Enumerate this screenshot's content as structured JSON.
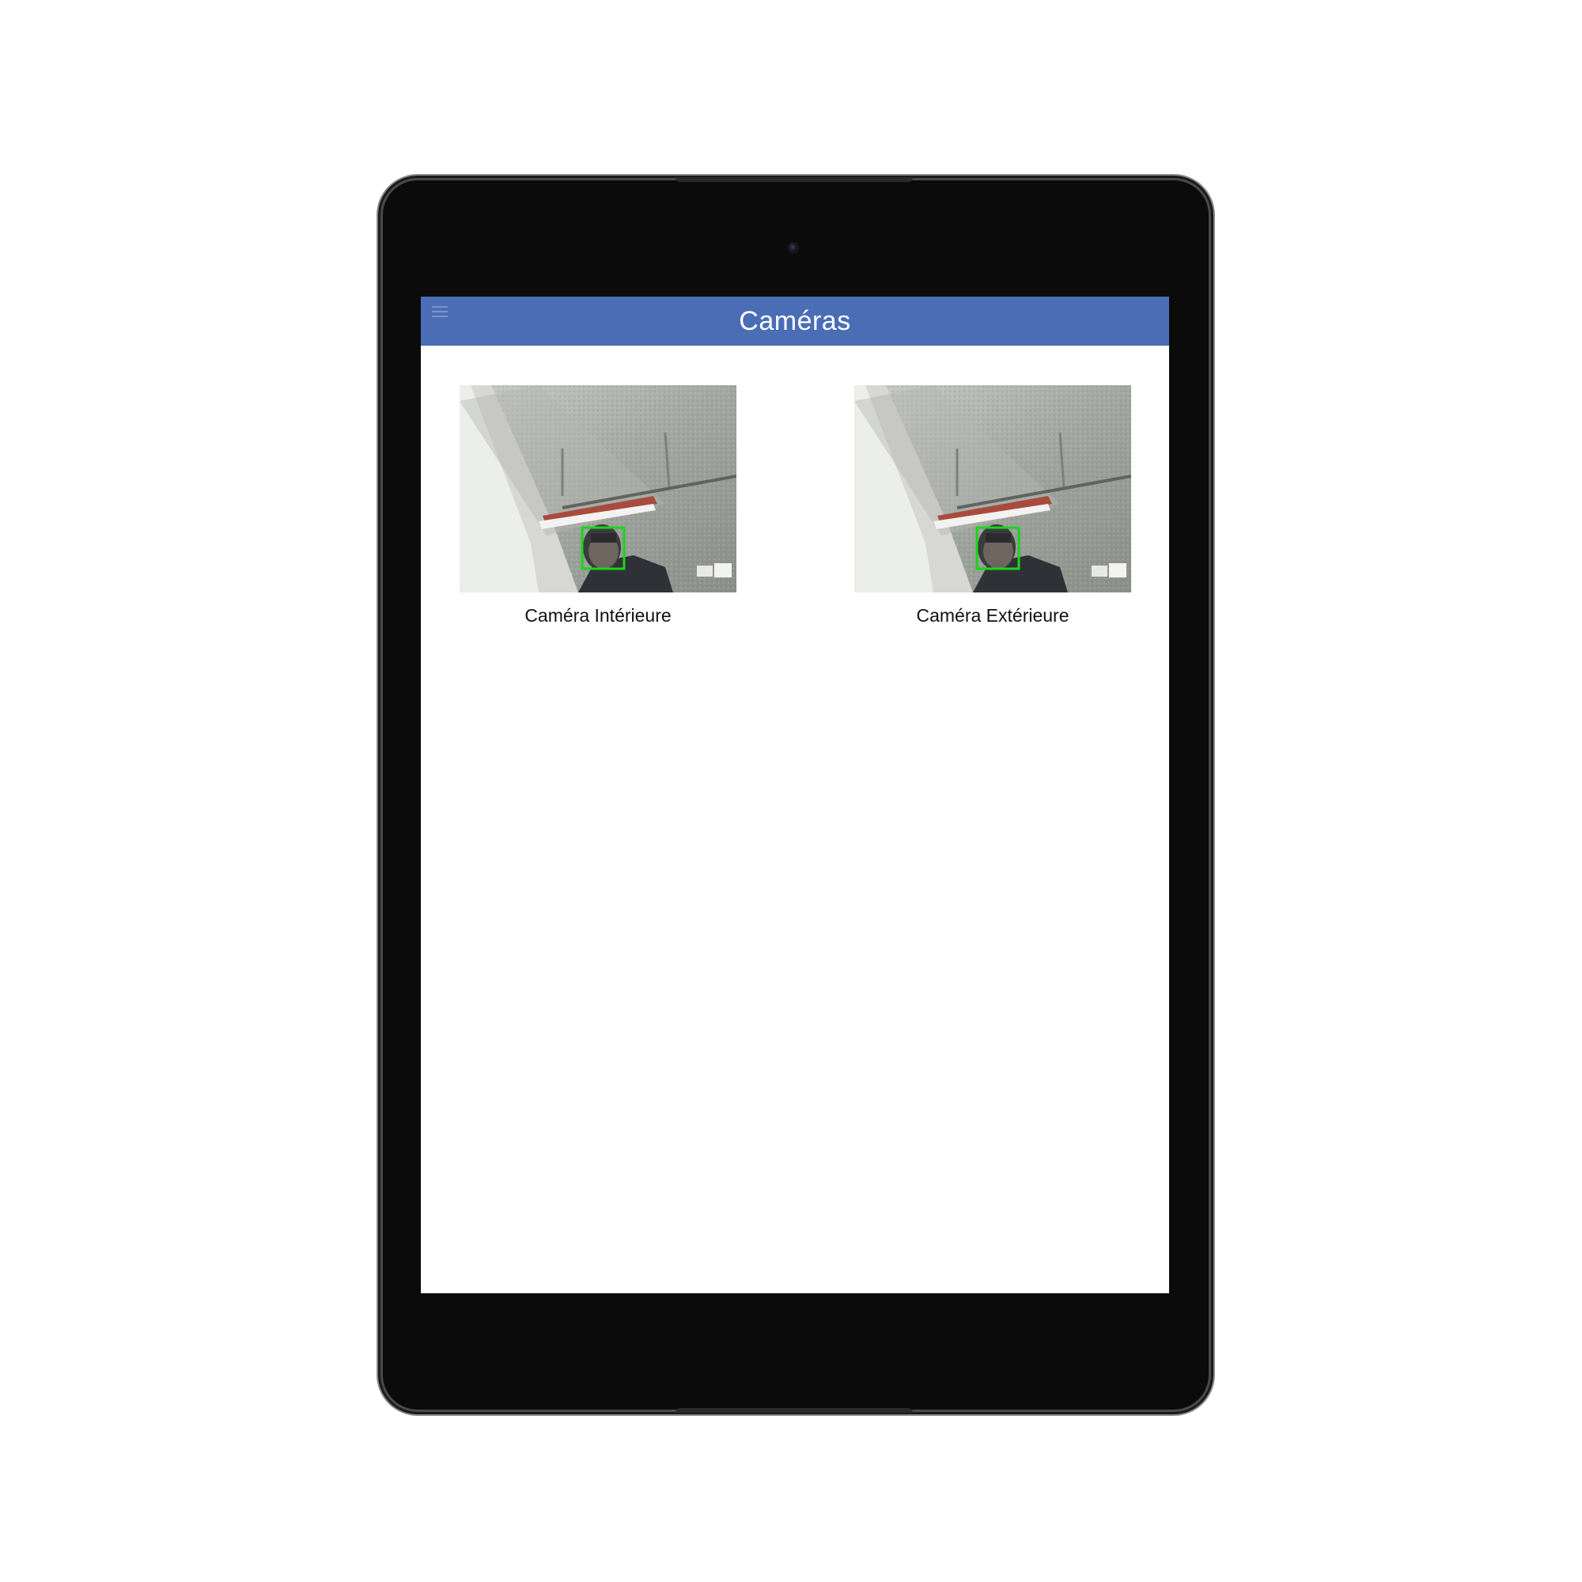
{
  "app": {
    "header_title": "Caméras",
    "accent_color": "#4a6db5"
  },
  "cameras": [
    {
      "label": "Caméra Intérieure",
      "detection_box_color": "#19d619"
    },
    {
      "label": "Caméra Extérieure",
      "detection_box_color": "#19d619"
    }
  ],
  "icons": {
    "menu": "hamburger-menu-icon"
  }
}
